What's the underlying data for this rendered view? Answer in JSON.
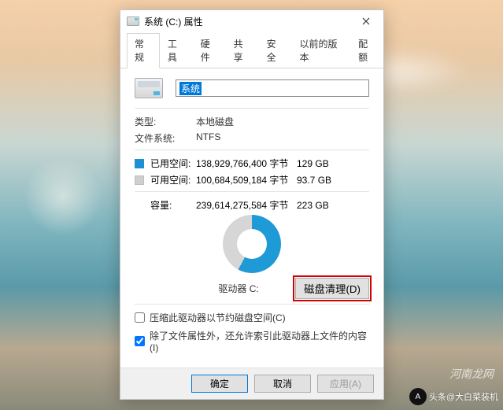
{
  "window": {
    "title": "系统 (C:) 属性"
  },
  "tabs": [
    "常规",
    "工具",
    "硬件",
    "共享",
    "安全",
    "以前的版本",
    "配额"
  ],
  "general": {
    "volume_name": "系统",
    "type_label": "类型:",
    "type_value": "本地磁盘",
    "filesystem_label": "文件系统:",
    "filesystem_value": "NTFS",
    "used_label": "已用空间:",
    "used_bytes": "138,929,766,400 字节",
    "used_gb": "129 GB",
    "free_label": "可用空间:",
    "free_bytes": "100,684,509,184 字节",
    "free_gb": "93.7 GB",
    "capacity_label": "容量:",
    "capacity_bytes": "239,614,275,584 字节",
    "capacity_gb": "223 GB",
    "drive_label": "驱动器 C:",
    "cleanup_button": "磁盘清理(D)",
    "compress_checkbox": "压缩此驱动器以节约磁盘空间(C)",
    "index_checkbox": "除了文件属性外，还允许索引此驱动器上文件的内容(I)"
  },
  "buttons": {
    "ok": "确定",
    "cancel": "取消",
    "apply": "应用(A)"
  },
  "watermark": {
    "site": "河南龙网",
    "source": "头条@大白菜装机"
  },
  "colors": {
    "used": "#1e9ad6",
    "free": "#d6d6d6",
    "highlight_box": "#d40000"
  },
  "chart_data": {
    "type": "pie",
    "title": "驱动器 C:",
    "series": [
      {
        "name": "已用空间",
        "value": 129,
        "unit": "GB",
        "bytes": 138929766400
      },
      {
        "name": "可用空间",
        "value": 93.7,
        "unit": "GB",
        "bytes": 100684509184
      }
    ],
    "total": {
      "name": "容量",
      "value": 223,
      "unit": "GB",
      "bytes": 239614275584
    }
  }
}
